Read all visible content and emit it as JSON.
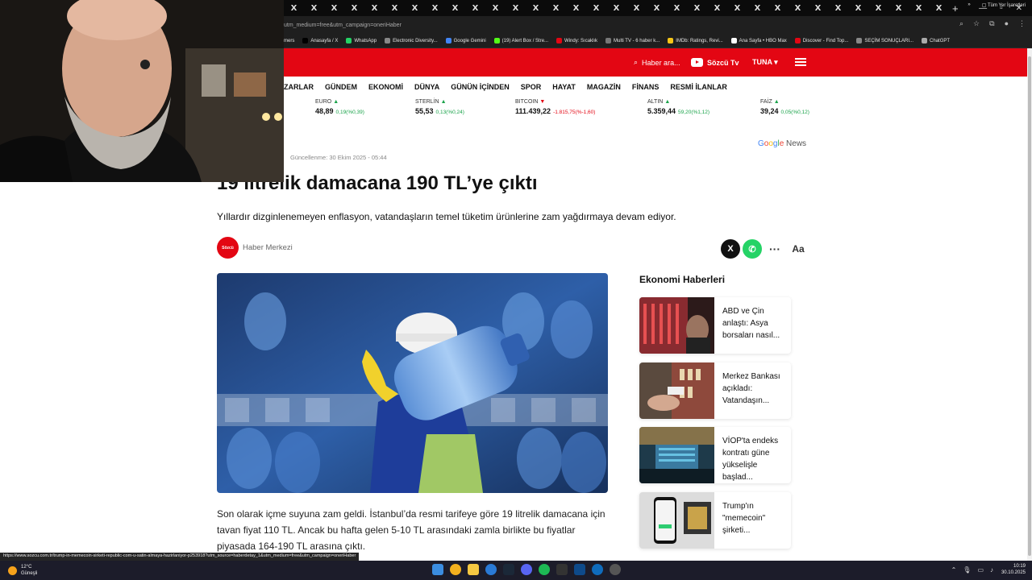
{
  "browser": {
    "url": "utm_medium=free&utm_campaign=oneriHaber",
    "tab_glyph": "X",
    "new_tab": "+",
    "win_min": "—",
    "win_max": "▫",
    "win_close": "✕",
    "bookmarks": [
      {
        "label": "mers",
        "color": "#555555"
      },
      {
        "label": "Anasayfa / X",
        "color": "#000000"
      },
      {
        "label": "WhatsApp",
        "color": "#25d366"
      },
      {
        "label": "Electronic Diversity...",
        "color": "#888888"
      },
      {
        "label": "Google Gemini",
        "color": "#4285f4"
      },
      {
        "label": "(19) Alert Box / Stre...",
        "color": "#53fc18"
      },
      {
        "label": "Windy: Sıcaklık",
        "color": "#e30613"
      },
      {
        "label": "Multi TV - 6 haber k...",
        "color": "#777777"
      },
      {
        "label": "IMDb: Ratings, Revi...",
        "color": "#f5c518"
      },
      {
        "label": "Ana Sayfa • HBO Max",
        "color": "#ffffff"
      },
      {
        "label": "Discover - Find Top...",
        "color": "#e30613"
      },
      {
        "label": "SEÇİM SONUÇLARI...",
        "color": "#888888"
      },
      {
        "label": "ChatGPT",
        "color": "#aaaaaa"
      }
    ],
    "bookmarks_more": "»",
    "bookmarks_all": "Tüm Yer İşaretleri"
  },
  "header": {
    "search_label": "Haber ara...",
    "tv_label": "Sözcü Tv",
    "user_label": "TUNA ▾"
  },
  "nav": [
    "ZARLAR",
    "GÜNDEM",
    "EKONOMİ",
    "DÜNYA",
    "GÜNÜN İÇİNDEN",
    "SPOR",
    "HAYAT",
    "MAGAZİN",
    "FİNANS",
    "RESMİ İLANLAR"
  ],
  "ticker": [
    {
      "name": "EURO",
      "dir": "▲",
      "value": "48,89",
      "change": "0,19(%0,39)",
      "trend": "up"
    },
    {
      "name": "STERLİN",
      "dir": "▲",
      "value": "55,53",
      "change": "0,13(%0,24)",
      "trend": "up"
    },
    {
      "name": "BITCOIN",
      "dir": "▼",
      "value": "111.439,22",
      "change": "-1.815,75(%-1,60)",
      "trend": "down"
    },
    {
      "name": "ALTIN",
      "dir": "▲",
      "value": "5.359,44",
      "change": "59,20(%1,12)",
      "trend": "up"
    },
    {
      "name": "FAİZ",
      "dir": "▲",
      "value": "39,24",
      "change": "0,05(%0,12)",
      "trend": "up"
    }
  ],
  "google_news": {
    "g": "G",
    "o1": "o",
    "o2": "o",
    "g2": "g",
    "l": "l",
    "e": "e",
    "rest": " News"
  },
  "article": {
    "updated": "Güncellenme: 30 Ekim 2025 - 05:44",
    "title": "19 litrelik damacana 190 TL’ye çıktı",
    "summary": "Yıllardır dizginlenemeyen enflasyon, vatandaşların temel tüketim ürünlerine zam yağdırmaya devam ediyor.",
    "author_logo": "Sözcü",
    "author": "Haber Merkezi",
    "body": "Son olarak içme suyuna zam geldi. İstanbul’da resmi tarifeye göre 19 litrelik damacana için tavan fiyat 110 TL. Ancak bu hafta gelen 5-10 TL arasındaki zamla birlikte bu fiyatlar piyasada 164-190 TL arasına çıktı."
  },
  "share": {
    "x": "X",
    "wa": "✆",
    "more": "···",
    "font": "Aa"
  },
  "sidebar": {
    "title": "Ekonomi Haberleri",
    "items": [
      {
        "text": "ABD ve Çin anlaştı: Asya borsaları nasıl..."
      },
      {
        "text": "Merkez Bankası açıkladı: Vatandaşın..."
      },
      {
        "text": "VİOP'ta endeks kontratı güne yükselişle başlad..."
      },
      {
        "text": "Trump'ın \"memecoin\" şirketi..."
      }
    ]
  },
  "status_url": "https://www.sozcu.com.tr/trump-in-memecoin-sirketi-republic-com-u-satin-almaya-hazirlaniyor-p253918?utm_source=haberdetay_1&utm_medium=free&utm_campaign=oneriHaber",
  "taskbar": {
    "temp": "12°C",
    "weather": "Güneşli",
    "time": "10:19",
    "date": "30.10.2025"
  }
}
